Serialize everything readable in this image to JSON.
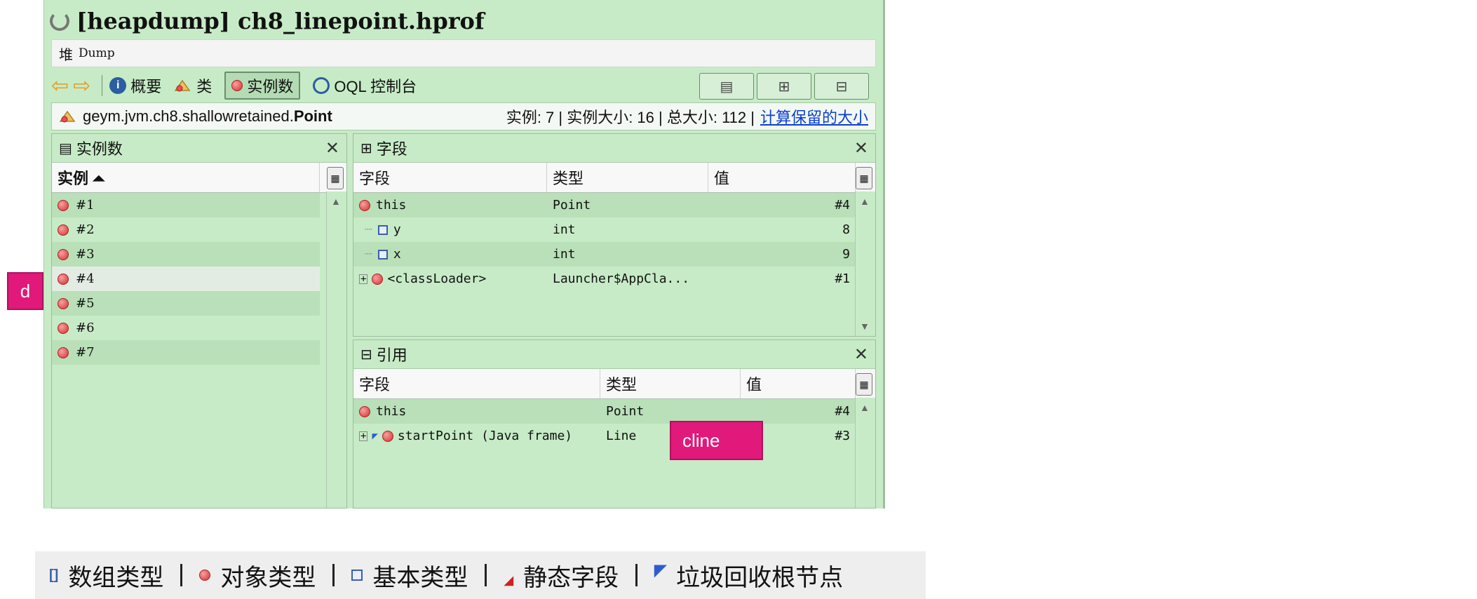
{
  "window": {
    "title": "[heapdump] ch8_linepoint.hprof",
    "dump_icon_label": "堆",
    "dump_label": "Dump"
  },
  "toolbar": {
    "summary_label": "概要",
    "classes_label": "类",
    "instances_label": "实例数",
    "oql_label": "OQL 控制台"
  },
  "classbar": {
    "class_prefix": "geym.jvm.ch8.shallowretained.",
    "class_name": "Point",
    "stats": "实例: 7  |  实例大小: 16  |  总大小: 112  |",
    "compute_link": "计算保留的大小"
  },
  "instances_panel": {
    "title": "实例数",
    "column": "实例 ⏶",
    "rows": [
      "#1",
      "#2",
      "#3",
      "#4",
      "#5",
      "#6",
      "#7"
    ],
    "selected_index": 3
  },
  "fields_panel": {
    "title": "字段",
    "columns": [
      "字段",
      "类型",
      "值"
    ],
    "rows": [
      {
        "field": "this",
        "type": "Point",
        "value": "#4"
      },
      {
        "field": "y",
        "type": "int",
        "value": "8"
      },
      {
        "field": "x",
        "type": "int",
        "value": "9"
      },
      {
        "field": "<classLoader>",
        "type": "Launcher$AppCla...",
        "value": "#1"
      }
    ]
  },
  "refs_panel": {
    "title": "引用",
    "columns": [
      "字段",
      "类型",
      "值"
    ],
    "rows": [
      {
        "field": "this",
        "type": "Point",
        "value": "#4"
      },
      {
        "field": "startPoint (Java frame)",
        "type": "Line",
        "value": "#3"
      }
    ]
  },
  "annotations": {
    "d_label": "d",
    "cline_label": "cline"
  },
  "legend": {
    "array": "数组类型",
    "object": "对象类型",
    "primitive": "基本类型",
    "static": "静态字段",
    "gcroot": "垃圾回收根节点"
  },
  "colors": {
    "panel_bg": "#c7ebc7",
    "accent_tag": "#e0197a",
    "link": "#0b3fd0"
  }
}
